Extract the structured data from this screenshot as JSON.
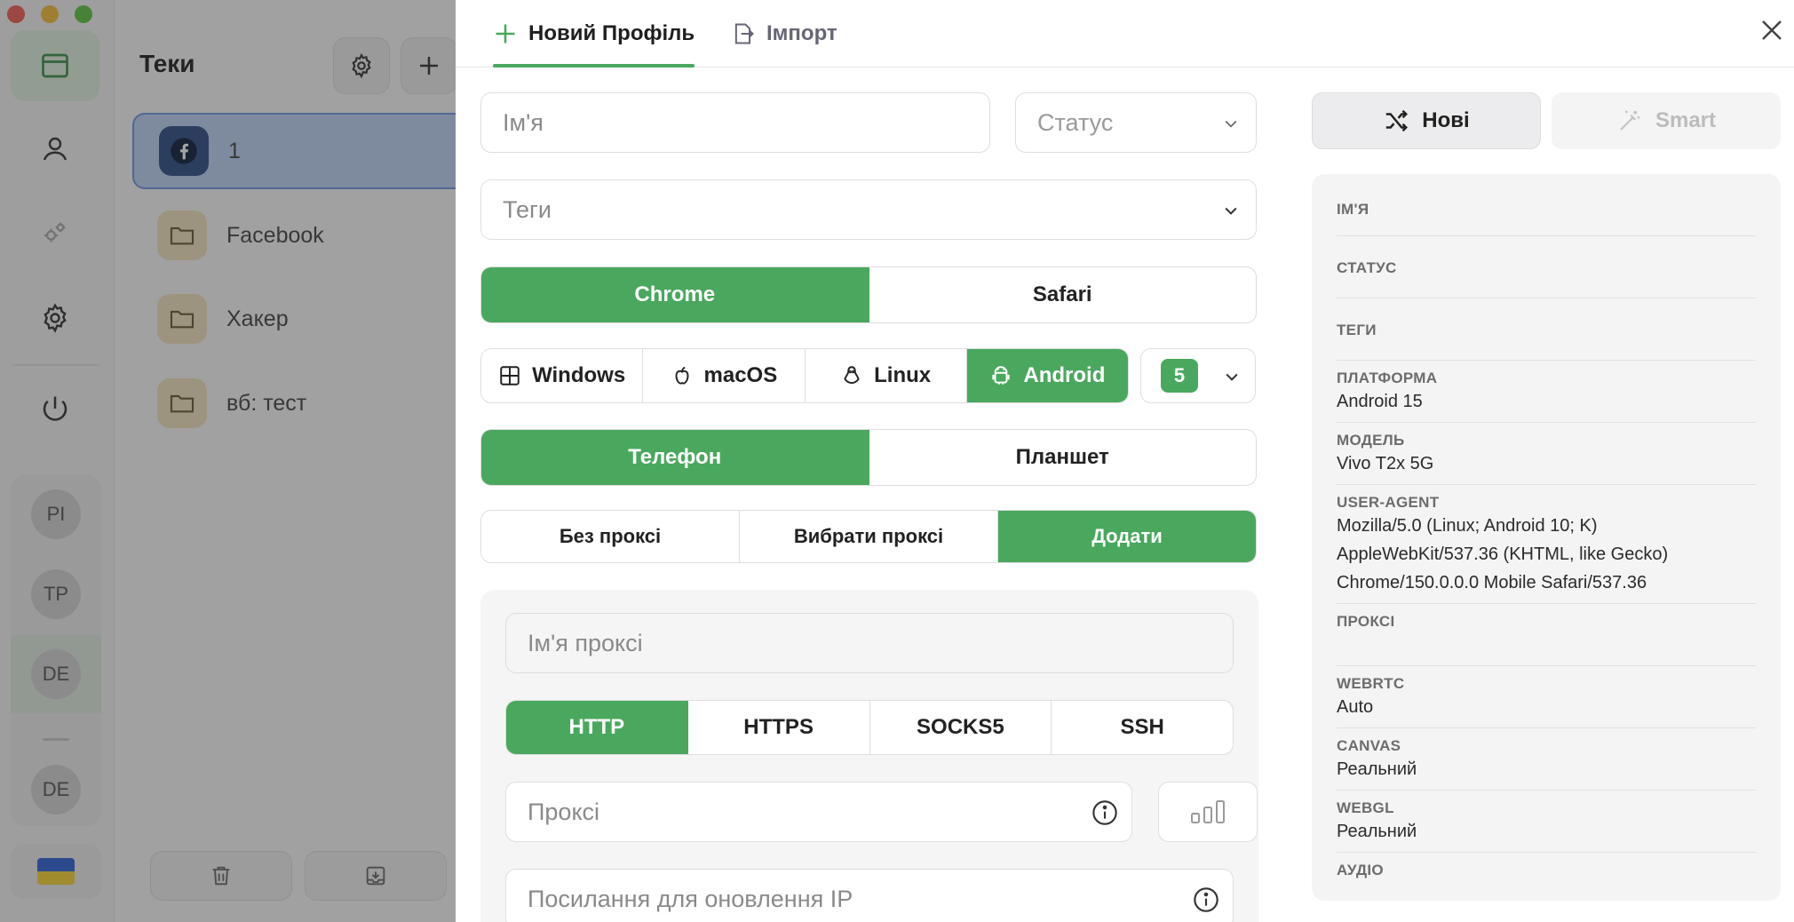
{
  "sidebar": {
    "profiles": [
      "PI",
      "TP",
      "DE",
      "DE"
    ]
  },
  "folders": {
    "title": "Теки",
    "items": [
      {
        "label": "1"
      },
      {
        "label": "Facebook"
      },
      {
        "label": "Хакер"
      },
      {
        "label": "вб: тест"
      }
    ]
  },
  "tabs": {
    "new_profile": "Новий Профіль",
    "import": "Імпорт"
  },
  "form": {
    "name_placeholder": "Ім'я",
    "status_placeholder": "Статус",
    "tags_placeholder": "Теги",
    "browsers": [
      "Chrome",
      "Safari"
    ],
    "selected_browser": "Chrome",
    "os": [
      "Windows",
      "macOS",
      "Linux",
      "Android"
    ],
    "selected_os": "Android",
    "os_version": "5",
    "device_types": [
      "Телефон",
      "Планшет"
    ],
    "selected_device": "Телефон",
    "proxy_modes": [
      "Без проксі",
      "Вибрати проксі",
      "Додати"
    ],
    "selected_proxy_mode": "Додати",
    "proxy_name_placeholder": "Ім'я проксі",
    "proxy_protocols": [
      "HTTP",
      "HTTPS",
      "SOCKS5",
      "SSH"
    ],
    "selected_protocol": "HTTP",
    "proxy_placeholder": "Проксі",
    "refresh_url_placeholder": "Посилання для оновлення IP"
  },
  "preview": {
    "new_button": "Нові",
    "smart_button": "Smart",
    "rows": [
      {
        "label": "Ім'я",
        "value": ""
      },
      {
        "label": "Статус",
        "value": ""
      },
      {
        "label": "Теги",
        "value": ""
      },
      {
        "label": "Платформа",
        "value": "Android 15"
      },
      {
        "label": "Модель",
        "value": "Vivo T2x 5G"
      },
      {
        "label": "User-Agent",
        "value": "Mozilla/5.0 (Linux; Android 10; K) AppleWebKit/537.36 (KHTML, like Gecko) Chrome/150.0.0.0 Mobile Safari/537.36"
      },
      {
        "label": "Проксі",
        "value": ""
      },
      {
        "label": "WebRTC",
        "value": "Auto"
      },
      {
        "label": "Canvas",
        "value": "Реальний"
      },
      {
        "label": "WebGL",
        "value": "Реальний"
      },
      {
        "label": "Аудіо",
        "value": ""
      }
    ]
  },
  "colors": {
    "accent": "#4aa85e",
    "overlay": "#282828"
  }
}
